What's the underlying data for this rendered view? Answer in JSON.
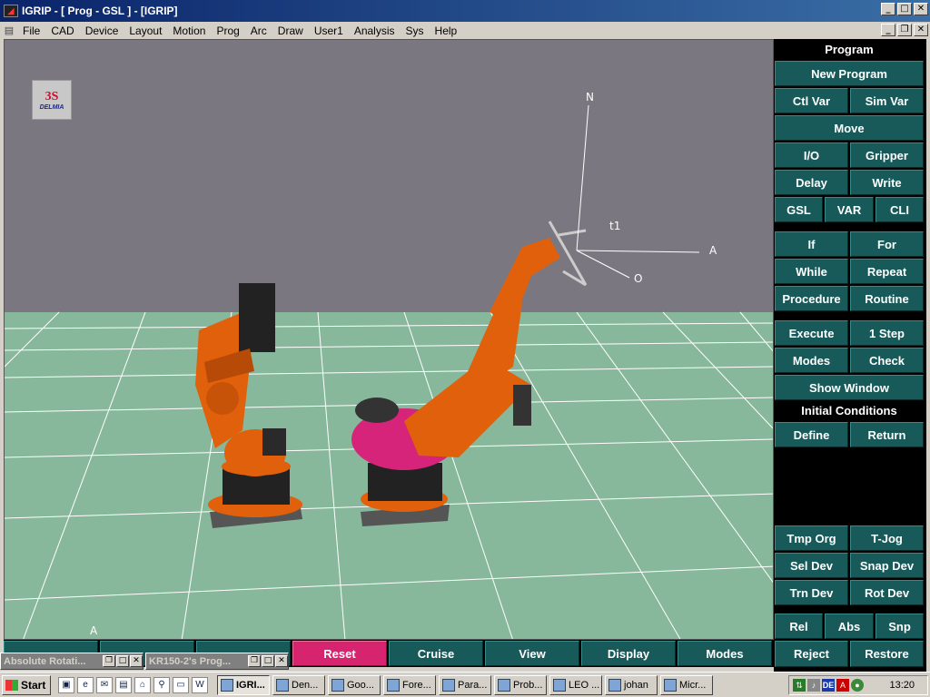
{
  "window": {
    "title": "IGRIP - [ Prog - GSL ] - [IGRIP]"
  },
  "menu": [
    "File",
    "CAD",
    "Device",
    "Layout",
    "Motion",
    "Prog",
    "Arc",
    "Draw",
    "User1",
    "Analysis",
    "Sys",
    "Help"
  ],
  "viewport": {
    "logo_text": "DELMIA",
    "axis_labels": {
      "n": "N",
      "a": "A",
      "o": "O",
      "t1": "t1",
      "bottom_a": "A"
    }
  },
  "panel": {
    "program_header": "Program",
    "new_program": "New Program",
    "ctl_var": "Ctl Var",
    "sim_var": "Sim Var",
    "move": "Move",
    "io": "I/O",
    "gripper": "Gripper",
    "delay": "Delay",
    "write": "Write",
    "gsl": "GSL",
    "var": "VAR",
    "cli": "CLI",
    "if": "If",
    "for": "For",
    "while": "While",
    "repeat": "Repeat",
    "procedure": "Procedure",
    "routine": "Routine",
    "execute": "Execute",
    "one_step": "1 Step",
    "modes": "Modes",
    "check": "Check",
    "show_window": "Show Window",
    "initial_conditions": "Initial Conditions",
    "define": "Define",
    "return": "Return",
    "tmp_org": "Tmp Org",
    "t_jog": "T-Jog",
    "sel_dev": "Sel Dev",
    "snap_dev": "Snap Dev",
    "trn_dev": "Trn Dev",
    "rot_dev": "Rot Dev",
    "rel": "Rel",
    "abs": "Abs",
    "snp": "Snp",
    "reject": "Reject",
    "restore": "Restore"
  },
  "bottombar": {
    "reset": "Reset",
    "cruise": "Cruise",
    "view": "View",
    "display": "Display",
    "modes": "Modes"
  },
  "minimized": {
    "win1": "Absolute Rotati...",
    "win2": "KR150-2's Prog..."
  },
  "taskbar": {
    "start": "Start",
    "items": [
      "IGRI...",
      "Den...",
      "Goo...",
      "Fore...",
      "Para...",
      "Prob...",
      "LEO ...",
      "johan",
      "Micr..."
    ],
    "lang": "DE",
    "clock": "13:20"
  },
  "colors": {
    "panel_button": "#185a5a",
    "reset_button": "#d6246e",
    "floor": "#87b89b",
    "sky": "#7b7780",
    "robot": "#e0600c",
    "robot_base_pink": "#d6247a"
  }
}
